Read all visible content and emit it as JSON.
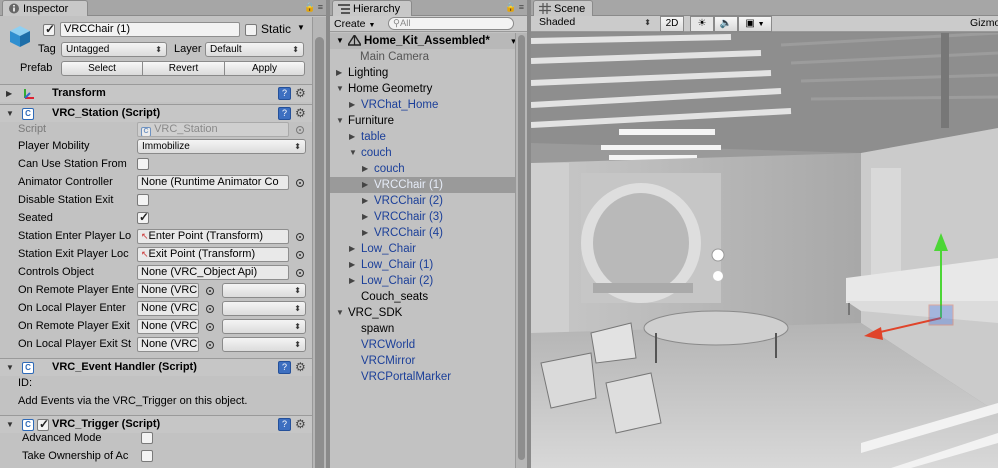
{
  "inspector": {
    "tab_label": "Inspector",
    "object_name": "VRCChair (1)",
    "static_label": "Static",
    "tag_label": "Tag",
    "tag_value": "Untagged",
    "layer_label": "Layer",
    "layer_value": "Default",
    "prefab_label": "Prefab",
    "prefab_buttons": [
      "Select",
      "Revert",
      "Apply"
    ],
    "transform_title": "Transform",
    "station": {
      "title": "VRC_Station (Script)",
      "rows": [
        {
          "label": "Script",
          "value": "VRC_Station"
        },
        {
          "label": "Player Mobility",
          "value": "Immobilize"
        },
        {
          "label": "Can Use Station From",
          "value": "false"
        },
        {
          "label": "Animator Controller",
          "value": "None (Runtime Animator Co"
        },
        {
          "label": "Disable Station Exit",
          "value": "false"
        },
        {
          "label": "Seated",
          "value": "true"
        },
        {
          "label": "Station Enter Player Lo",
          "value": "Enter Point (Transform)"
        },
        {
          "label": "Station Exit Player Loc",
          "value": "Exit Point (Transform)"
        },
        {
          "label": "Controls Object",
          "value": "None (VRC_Object Api)"
        },
        {
          "label": "On Remote Player Ente",
          "value": "None (VRC"
        },
        {
          "label": "On Local Player Enter",
          "value": "None (VRC"
        },
        {
          "label": "On Remote Player Exit",
          "value": "None (VRC"
        },
        {
          "label": "On Local Player Exit St",
          "value": "None (VRC"
        }
      ]
    },
    "event_handler": {
      "title": "VRC_Event Handler (Script)",
      "id_label": "ID:",
      "help": "Add Events via the VRC_Trigger on this object."
    },
    "trigger": {
      "title": "VRC_Trigger (Script)",
      "rows": [
        {
          "label": "Advanced Mode"
        },
        {
          "label": "Take Ownership of Ac"
        }
      ]
    }
  },
  "hierarchy": {
    "tab_label": "Hierarchy",
    "create_label": "Create",
    "search_placeholder": "All",
    "scene_name": "Home_Kit_Assembled*",
    "items": [
      {
        "label": "Main Camera",
        "depth": 0,
        "fold": "none",
        "color": "gray"
      },
      {
        "label": "Lighting",
        "depth": 0,
        "fold": "closed",
        "color": "black"
      },
      {
        "label": "Home Geometry",
        "depth": 0,
        "fold": "open",
        "color": "black"
      },
      {
        "label": "VRChat_Home",
        "depth": 1,
        "fold": "closed",
        "color": "blue"
      },
      {
        "label": "Furniture",
        "depth": 0,
        "fold": "open",
        "color": "black"
      },
      {
        "label": "table",
        "depth": 1,
        "fold": "closed",
        "color": "blue"
      },
      {
        "label": "couch",
        "depth": 1,
        "fold": "open",
        "color": "blue"
      },
      {
        "label": "couch",
        "depth": 2,
        "fold": "closed",
        "color": "blue"
      },
      {
        "label": "VRCChair (1)",
        "depth": 2,
        "fold": "closed",
        "color": "blue",
        "selected": true
      },
      {
        "label": "VRCChair (2)",
        "depth": 2,
        "fold": "closed",
        "color": "blue"
      },
      {
        "label": "VRCChair (3)",
        "depth": 2,
        "fold": "closed",
        "color": "blue"
      },
      {
        "label": "VRCChair (4)",
        "depth": 2,
        "fold": "closed",
        "color": "blue"
      },
      {
        "label": "Low_Chair",
        "depth": 1,
        "fold": "closed",
        "color": "blue"
      },
      {
        "label": "Low_Chair (1)",
        "depth": 1,
        "fold": "closed",
        "color": "blue"
      },
      {
        "label": "Low_Chair (2)",
        "depth": 1,
        "fold": "closed",
        "color": "blue"
      },
      {
        "label": "Couch_seats",
        "depth": 1,
        "fold": "none",
        "color": "black"
      },
      {
        "label": "VRC_SDK",
        "depth": 0,
        "fold": "open",
        "color": "black"
      },
      {
        "label": "spawn",
        "depth": 1,
        "fold": "none",
        "color": "black"
      },
      {
        "label": "VRCWorld",
        "depth": 1,
        "fold": "none",
        "color": "blue"
      },
      {
        "label": "VRCMirror",
        "depth": 1,
        "fold": "none",
        "color": "blue"
      },
      {
        "label": "VRCPortalMarker",
        "depth": 1,
        "fold": "none",
        "color": "blue"
      }
    ]
  },
  "scene": {
    "tab_label": "Scene",
    "shading_mode": "Shaded",
    "mode_2d": "2D",
    "gizmos_label": "Gizmos",
    "icons": [
      "sun-icon",
      "speaker-icon",
      "image-icon"
    ]
  },
  "colors": {
    "selection": "#9a9a9a",
    "prefab_blue": "#1b3f99",
    "gizmo_y": "#4cd636",
    "gizmo_x": "#e0442a",
    "gizmo_z": "#3b6fe0"
  }
}
